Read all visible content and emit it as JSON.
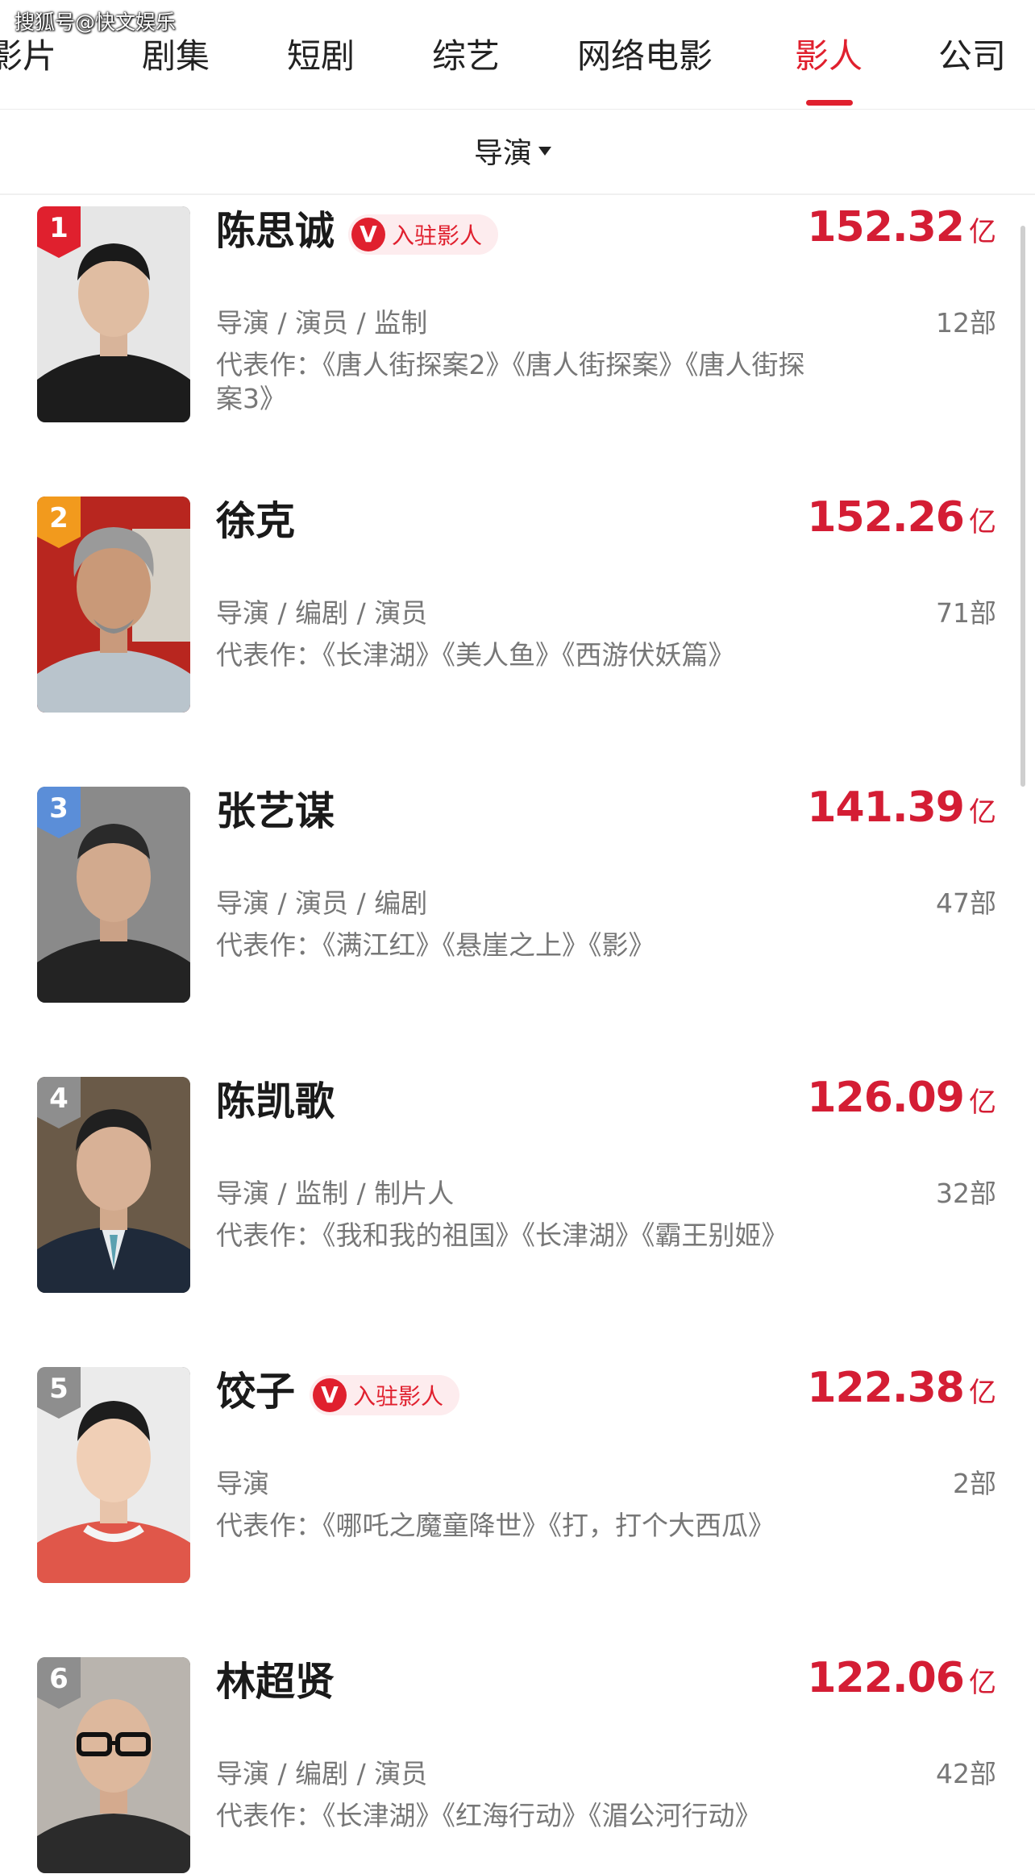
{
  "watermark": "搜狐号@快文娱乐",
  "tabs": [
    {
      "label": "影片"
    },
    {
      "label": "剧集"
    },
    {
      "label": "短剧"
    },
    {
      "label": "综艺"
    },
    {
      "label": "网络电影"
    },
    {
      "label": "影人",
      "active": true
    },
    {
      "label": "公司"
    }
  ],
  "filter": {
    "label": "导演"
  },
  "badge_label": "入驻影人",
  "badge_icon_letter": "V",
  "colors": {
    "accent": "#e0202e",
    "box_office": "#d41d34",
    "rank1": "#e0202e",
    "rank2": "#f29a1d",
    "rank3": "#5b8ed8",
    "rank_other": "#8e8e8e"
  },
  "people": [
    {
      "rank": "1",
      "name": "陈思诚",
      "verified": true,
      "box_value": "152.32",
      "box_unit": "亿",
      "roles": "导演 / 演员 / 监制",
      "count": "12部",
      "works": "代表作：《唐人街探案2》《唐人街探案》《唐人街探案3》"
    },
    {
      "rank": "2",
      "name": "徐克",
      "verified": false,
      "box_value": "152.26",
      "box_unit": "亿",
      "roles": "导演 / 编剧 / 演员",
      "count": "71部",
      "works": "代表作：《长津湖》《美人鱼》《西游伏妖篇》"
    },
    {
      "rank": "3",
      "name": "张艺谋",
      "verified": false,
      "box_value": "141.39",
      "box_unit": "亿",
      "roles": "导演 / 演员 / 编剧",
      "count": "47部",
      "works": "代表作：《满江红》《悬崖之上》《影》"
    },
    {
      "rank": "4",
      "name": "陈凯歌",
      "verified": false,
      "box_value": "126.09",
      "box_unit": "亿",
      "roles": "导演 / 监制 / 制片人",
      "count": "32部",
      "works": "代表作：《我和我的祖国》《长津湖》《霸王别姬》"
    },
    {
      "rank": "5",
      "name": "饺子",
      "verified": true,
      "box_value": "122.38",
      "box_unit": "亿",
      "roles": "导演",
      "count": "2部",
      "works": "代表作：《哪吒之魔童降世》《打，打个大西瓜》"
    },
    {
      "rank": "6",
      "name": "林超贤",
      "verified": false,
      "box_value": "122.06",
      "box_unit": "亿",
      "roles": "导演 / 编剧 / 演员",
      "count": "42部",
      "works": "代表作：《长津湖》《红海行动》《湄公河行动》"
    }
  ]
}
